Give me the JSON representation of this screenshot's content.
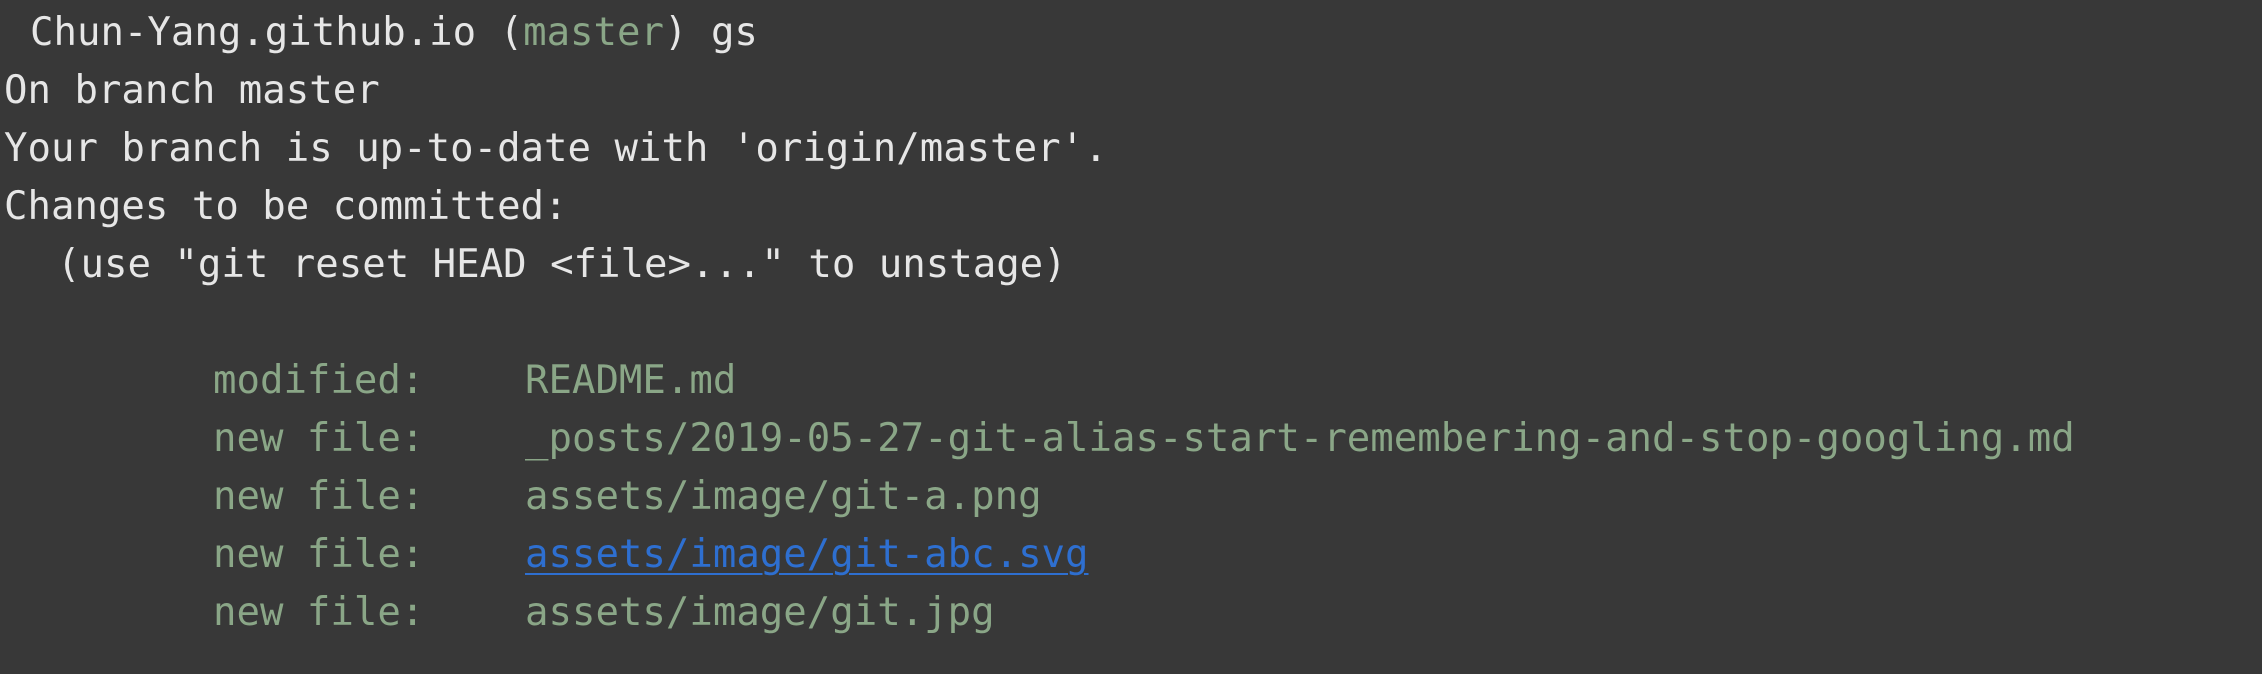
{
  "prompt": {
    "directory": "Chun-Yang.github.io",
    "open_paren": " (",
    "branch": "master",
    "close_paren": ") ",
    "command": "gs"
  },
  "output": {
    "line_branch": "On branch master",
    "line_uptodate": "Your branch is up-to-date with 'origin/master'.",
    "line_changes": "Changes to be committed:",
    "line_hint": "(use \"git reset HEAD <file>...\" to unstage)"
  },
  "files": [
    {
      "status": "modified:",
      "path": "README.md"
    },
    {
      "status": "new file:",
      "path": "_posts/2019-05-27-git-alias-start-remembering-and-stop-googling.md"
    },
    {
      "status": "new file:",
      "path": "assets/image/git-a.png"
    },
    {
      "status": "new file:",
      "path": "assets/image/git-abc.svg"
    },
    {
      "status": "new file:",
      "path": "assets/image/git.jpg"
    }
  ],
  "colors": {
    "background": "#383838",
    "text": "#e6e6e6",
    "staged": "#8aa687",
    "link": "#2e6fd0"
  }
}
